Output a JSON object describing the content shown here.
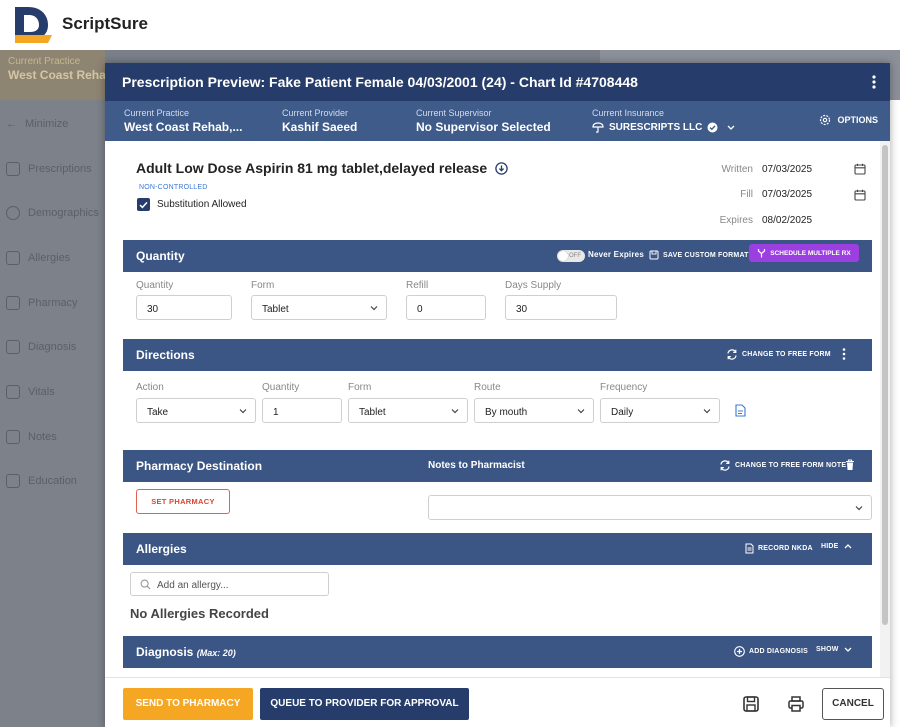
{
  "app": {
    "brand": "ScriptSure"
  },
  "background": {
    "practice_label": "Current Practice",
    "practice_value": "West Coast Rehab",
    "minimize": "Minimize",
    "nav": [
      "Prescriptions",
      "Demographics",
      "Allergies",
      "Pharmacy",
      "Diagnosis",
      "Vitals",
      "Notes",
      "Education"
    ]
  },
  "modal": {
    "title": "Prescription Preview: Fake Patient Female 04/03/2001 (24) - Chart Id #4708448",
    "info": {
      "practice_label": "Current Practice",
      "practice_value": "West Coast Rehab,...",
      "provider_label": "Current Provider",
      "provider_value": "Kashif Saeed",
      "supervisor_label": "Current Supervisor",
      "supervisor_value": "No Supervisor Selected",
      "insurance_label": "Current Insurance",
      "insurance_value": "SURESCRIPTS LLC",
      "options": "OPTIONS"
    },
    "drug": {
      "name": "Adult Low Dose Aspirin 81 mg tablet,delayed release",
      "schedule": "NON-CONTROLLED",
      "substitution": "Substitution Allowed"
    },
    "dates": {
      "written_label": "Written",
      "written": "07/03/2025",
      "fill_label": "Fill",
      "fill": "07/03/2025",
      "expires_label": "Expires",
      "expires": "08/02/2025"
    },
    "quantity": {
      "title": "Quantity",
      "toggle": "OFF",
      "never_expires": "Never Expires",
      "save_custom": "SAVE CUSTOM FORMAT",
      "schedule_multiple": "SCHEDULE MULTIPLE RX",
      "labels": {
        "quantity": "Quantity",
        "form": "Form",
        "refill": "Refill",
        "days": "Days Supply"
      },
      "values": {
        "quantity": "30",
        "form": "Tablet",
        "refill": "0",
        "days": "30"
      }
    },
    "directions": {
      "title": "Directions",
      "change_free": "CHANGE TO FREE FORM",
      "labels": {
        "action": "Action",
        "quantity": "Quantity",
        "form": "Form",
        "route": "Route",
        "frequency": "Frequency"
      },
      "values": {
        "action": "Take",
        "quantity": "1",
        "form": "Tablet",
        "route": "By mouth",
        "frequency": "Daily"
      }
    },
    "pharmacy": {
      "title": "Pharmacy Destination",
      "notes_title": "Notes to Pharmacist",
      "change_note": "CHANGE TO FREE FORM NOTE",
      "set_pharmacy": "SET PHARMACY"
    },
    "allergies": {
      "title": "Allergies",
      "record_nkda": "RECORD NKDA",
      "hide": "HIDE",
      "search_placeholder": "Add an allergy...",
      "none": "No Allergies Recorded"
    },
    "diagnosis": {
      "title": "Diagnosis",
      "max": "(Max: 20)",
      "add": "ADD DIAGNOSIS",
      "show": "SHOW"
    },
    "footer": {
      "send": "SEND TO PHARMACY",
      "queue": "QUEUE TO PROVIDER FOR APPROVAL",
      "cancel": "CANCEL"
    }
  },
  "colors": {
    "navy": "#263d6b",
    "section": "#3b5584",
    "accent": "#f5a623",
    "purple": "#9b3fe0",
    "danger": "#d8442e"
  }
}
